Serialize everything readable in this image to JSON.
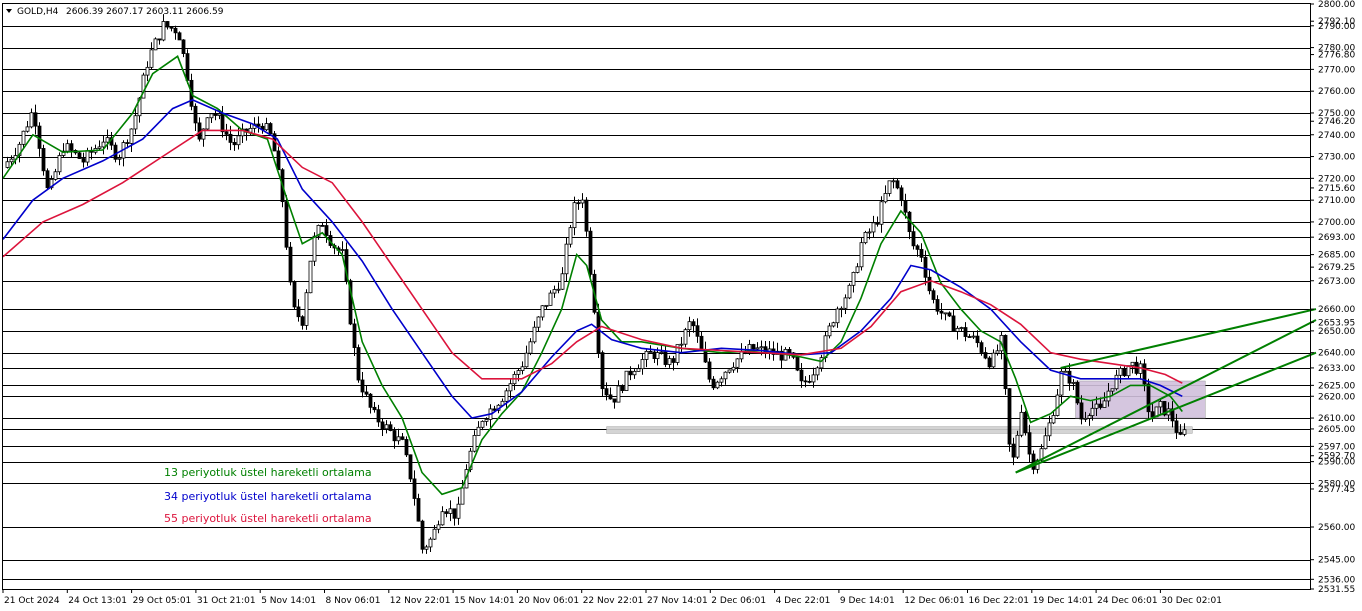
{
  "header": {
    "symbol": "GOLD,H4",
    "ohlc": "2606.39 2607.17 2603.11 2606.59"
  },
  "legend": [
    {
      "label": "13 periyotluk üstel hareketli ortalama",
      "color": "#008000"
    },
    {
      "label": "34 periyotluk üstel hareketli ortalama",
      "color": "#0000cc"
    },
    {
      "label": "55 periyotluk üstel hareketli ortalama",
      "color": "#dc143c"
    }
  ],
  "chart_data": {
    "type": "candlestick",
    "ylim": [
      2531.55,
      2800.0
    ],
    "xlim": [
      0,
      1310
    ],
    "y_ticks": [
      "2800.00",
      "2792.10",
      "2790.00",
      "2780.00",
      "2776.80",
      "2770.00",
      "2760.00",
      "2750.00",
      "2746.20",
      "2740.00",
      "2730.00",
      "2720.00",
      "2715.60",
      "2710.00",
      "2700.00",
      "2693.00",
      "2685.00",
      "2679.25",
      "2673.00",
      "2660.00",
      "2653.95",
      "2650.00",
      "2640.00",
      "2633.00",
      "2625.00",
      "2620.00",
      "2610.00",
      "2605.00",
      "2597.00",
      "2592.70",
      "2590.00",
      "2580.00",
      "2577.45",
      "2560.00",
      "2545.00",
      "2536.00",
      "2531.55"
    ],
    "horizontal_levels": [
      2790,
      2780,
      2770,
      2760,
      2750,
      2740,
      2730,
      2720,
      2710,
      2700,
      2693,
      2685,
      2673,
      2660,
      2650,
      2640,
      2633,
      2625,
      2620,
      2610,
      2605,
      2597,
      2590,
      2580,
      2560,
      2545,
      2536
    ],
    "x_labels": [
      "21 Oct 2024",
      "24 Oct 13:01",
      "29 Oct 05:01",
      "31 Oct 21:01",
      "5 Nov 14:01",
      "8 Nov 06:01",
      "12 Nov 22:01",
      "15 Nov 14:01",
      "20 Nov 06:01",
      "22 Nov 22:01",
      "27 Nov 14:01",
      "2 Dec 06:01",
      "4 Dec 22:01",
      "9 Dec 14:01",
      "12 Dec 06:01",
      "16 Dec 22:01",
      "19 Dec 14:01",
      "24 Dec 06:01",
      "30 Dec 02:01"
    ],
    "price_path": [
      [
        0,
        2725
      ],
      [
        15,
        2735
      ],
      [
        30,
        2752
      ],
      [
        45,
        2712
      ],
      [
        60,
        2735
      ],
      [
        80,
        2728
      ],
      [
        100,
        2738
      ],
      [
        115,
        2730
      ],
      [
        130,
        2745
      ],
      [
        145,
        2775
      ],
      [
        160,
        2790
      ],
      [
        175,
        2788
      ],
      [
        185,
        2765
      ],
      [
        195,
        2735
      ],
      [
        205,
        2752
      ],
      [
        215,
        2748
      ],
      [
        230,
        2735
      ],
      [
        245,
        2742
      ],
      [
        260,
        2745
      ],
      [
        270,
        2738
      ],
      [
        280,
        2710
      ],
      [
        290,
        2660
      ],
      [
        300,
        2655
      ],
      [
        310,
        2690
      ],
      [
        320,
        2700
      ],
      [
        330,
        2690
      ],
      [
        340,
        2685
      ],
      [
        355,
        2630
      ],
      [
        370,
        2612
      ],
      [
        385,
        2605
      ],
      [
        400,
        2598
      ],
      [
        410,
        2580
      ],
      [
        420,
        2550
      ],
      [
        430,
        2555
      ],
      [
        440,
        2570
      ],
      [
        455,
        2565
      ],
      [
        465,
        2590
      ],
      [
        480,
        2610
      ],
      [
        500,
        2620
      ],
      [
        520,
        2635
      ],
      [
        540,
        2660
      ],
      [
        560,
        2675
      ],
      [
        570,
        2705
      ],
      [
        580,
        2712
      ],
      [
        590,
        2670
      ],
      [
        600,
        2625
      ],
      [
        610,
        2618
      ],
      [
        630,
        2633
      ],
      [
        650,
        2640
      ],
      [
        670,
        2635
      ],
      [
        690,
        2655
      ],
      [
        710,
        2625
      ],
      [
        730,
        2635
      ],
      [
        750,
        2642
      ],
      [
        770,
        2640
      ],
      [
        790,
        2638
      ],
      [
        800,
        2625
      ],
      [
        810,
        2630
      ],
      [
        820,
        2640
      ],
      [
        835,
        2660
      ],
      [
        850,
        2670
      ],
      [
        860,
        2690
      ],
      [
        875,
        2700
      ],
      [
        890,
        2720
      ],
      [
        900,
        2712
      ],
      [
        910,
        2690
      ],
      [
        920,
        2685
      ],
      [
        930,
        2665
      ],
      [
        945,
        2655
      ],
      [
        960,
        2650
      ],
      [
        975,
        2645
      ],
      [
        990,
        2635
      ],
      [
        1000,
        2645
      ],
      [
        1010,
        2585
      ],
      [
        1020,
        2615
      ],
      [
        1030,
        2588
      ],
      [
        1040,
        2595
      ],
      [
        1050,
        2610
      ],
      [
        1060,
        2630
      ],
      [
        1070,
        2628
      ],
      [
        1080,
        2610
      ],
      [
        1090,
        2615
      ],
      [
        1100,
        2613
      ],
      [
        1110,
        2625
      ],
      [
        1120,
        2630
      ],
      [
        1130,
        2635
      ],
      [
        1140,
        2632
      ],
      [
        1150,
        2610
      ],
      [
        1160,
        2615
      ],
      [
        1170,
        2612
      ],
      [
        1180,
        2600
      ],
      [
        1185,
        2604
      ]
    ],
    "series": [
      {
        "name": "13 periyotluk üstel hareketli ortalama",
        "color": "#008000",
        "points": [
          [
            0,
            2720
          ],
          [
            30,
            2740
          ],
          [
            60,
            2732
          ],
          [
            100,
            2733
          ],
          [
            130,
            2750
          ],
          [
            150,
            2768
          ],
          [
            175,
            2776
          ],
          [
            190,
            2758
          ],
          [
            215,
            2752
          ],
          [
            240,
            2742
          ],
          [
            265,
            2738
          ],
          [
            285,
            2710
          ],
          [
            300,
            2690
          ],
          [
            320,
            2695
          ],
          [
            340,
            2685
          ],
          [
            360,
            2645
          ],
          [
            380,
            2625
          ],
          [
            400,
            2610
          ],
          [
            420,
            2585
          ],
          [
            440,
            2575
          ],
          [
            460,
            2578
          ],
          [
            480,
            2600
          ],
          [
            500,
            2612
          ],
          [
            520,
            2622
          ],
          [
            540,
            2640
          ],
          [
            560,
            2660
          ],
          [
            575,
            2685
          ],
          [
            585,
            2680
          ],
          [
            600,
            2655
          ],
          [
            620,
            2645
          ],
          [
            640,
            2645
          ],
          [
            680,
            2642
          ],
          [
            720,
            2640
          ],
          [
            760,
            2641
          ],
          [
            800,
            2638
          ],
          [
            820,
            2636
          ],
          [
            840,
            2645
          ],
          [
            860,
            2665
          ],
          [
            880,
            2690
          ],
          [
            900,
            2705
          ],
          [
            920,
            2695
          ],
          [
            940,
            2672
          ],
          [
            960,
            2660
          ],
          [
            980,
            2650
          ],
          [
            1000,
            2645
          ],
          [
            1015,
            2628
          ],
          [
            1030,
            2608
          ],
          [
            1050,
            2612
          ],
          [
            1070,
            2620
          ],
          [
            1090,
            2618
          ],
          [
            1110,
            2620
          ],
          [
            1130,
            2625
          ],
          [
            1150,
            2625
          ],
          [
            1170,
            2620
          ],
          [
            1182,
            2613
          ]
        ]
      },
      {
        "name": "34 periyotluk üstel hareketli ortalama",
        "color": "#0000cc",
        "points": [
          [
            0,
            2692
          ],
          [
            30,
            2710
          ],
          [
            60,
            2720
          ],
          [
            100,
            2728
          ],
          [
            140,
            2738
          ],
          [
            170,
            2752
          ],
          [
            190,
            2756
          ],
          [
            220,
            2750
          ],
          [
            250,
            2745
          ],
          [
            275,
            2738
          ],
          [
            300,
            2715
          ],
          [
            330,
            2700
          ],
          [
            360,
            2682
          ],
          [
            390,
            2660
          ],
          [
            420,
            2640
          ],
          [
            450,
            2620
          ],
          [
            470,
            2610
          ],
          [
            490,
            2612
          ],
          [
            520,
            2622
          ],
          [
            550,
            2638
          ],
          [
            575,
            2650
          ],
          [
            590,
            2653
          ],
          [
            610,
            2646
          ],
          [
            640,
            2642
          ],
          [
            680,
            2640
          ],
          [
            720,
            2642
          ],
          [
            760,
            2641
          ],
          [
            800,
            2639
          ],
          [
            830,
            2640
          ],
          [
            860,
            2650
          ],
          [
            890,
            2665
          ],
          [
            910,
            2680
          ],
          [
            930,
            2678
          ],
          [
            960,
            2670
          ],
          [
            990,
            2660
          ],
          [
            1020,
            2645
          ],
          [
            1050,
            2632
          ],
          [
            1080,
            2628
          ],
          [
            1110,
            2628
          ],
          [
            1140,
            2628
          ],
          [
            1160,
            2625
          ],
          [
            1182,
            2620
          ]
        ]
      },
      {
        "name": "55 periyotluk üstel hareketli ortalama",
        "color": "#dc143c",
        "points": [
          [
            0,
            2684
          ],
          [
            40,
            2700
          ],
          [
            80,
            2708
          ],
          [
            120,
            2718
          ],
          [
            160,
            2730
          ],
          [
            200,
            2742
          ],
          [
            240,
            2742
          ],
          [
            270,
            2738
          ],
          [
            300,
            2725
          ],
          [
            330,
            2718
          ],
          [
            360,
            2700
          ],
          [
            390,
            2680
          ],
          [
            420,
            2660
          ],
          [
            450,
            2640
          ],
          [
            480,
            2628
          ],
          [
            520,
            2628
          ],
          [
            550,
            2635
          ],
          [
            575,
            2645
          ],
          [
            600,
            2652
          ],
          [
            640,
            2646
          ],
          [
            680,
            2642
          ],
          [
            720,
            2641
          ],
          [
            760,
            2640
          ],
          [
            800,
            2639
          ],
          [
            840,
            2642
          ],
          [
            870,
            2652
          ],
          [
            900,
            2668
          ],
          [
            930,
            2673
          ],
          [
            960,
            2668
          ],
          [
            990,
            2662
          ],
          [
            1020,
            2653
          ],
          [
            1050,
            2640
          ],
          [
            1080,
            2637
          ],
          [
            1110,
            2635
          ],
          [
            1140,
            2633
          ],
          [
            1165,
            2630
          ],
          [
            1182,
            2626
          ]
        ]
      }
    ],
    "trendlines": [
      {
        "color": "#008000",
        "from": [
          1015,
          2585
        ],
        "to": [
          1320,
          2655
        ]
      },
      {
        "color": "#008000",
        "from": [
          1015,
          2585
        ],
        "to": [
          1320,
          2640
        ]
      },
      {
        "color": "#008000",
        "from": [
          1060,
          2633
        ],
        "to": [
          1320,
          2660
        ]
      }
    ],
    "zones": [
      {
        "color": "#d0c0dc",
        "x": [
          1075,
          1205
        ],
        "y": [
          2610,
          2627
        ]
      },
      {
        "color": "#cfcfcf",
        "x": [
          605,
          1192
        ],
        "y": [
          2603,
          2606
        ]
      }
    ]
  }
}
